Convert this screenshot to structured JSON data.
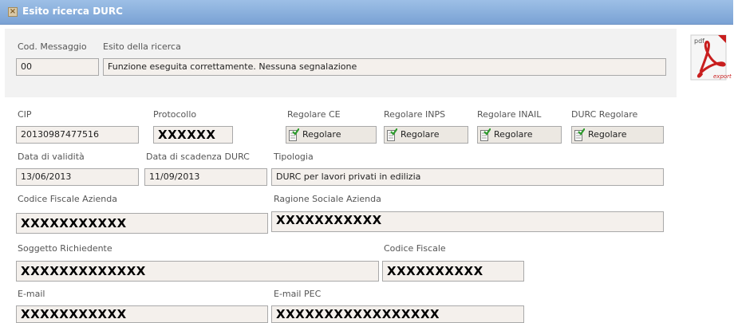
{
  "window": {
    "title": "Esito ricerca DURC",
    "close_icon": "close-icon"
  },
  "result": {
    "cod_label": "Cod. Messaggio",
    "cod_value": "00",
    "esito_label": "Esito della ricerca",
    "esito_value": "Funzione eseguita correttamente. Nessuna segnalazione"
  },
  "pdf_export": {
    "icon": "pdf-export-icon",
    "top_text": "pdf",
    "side_text": "export"
  },
  "details": {
    "cip_label": "CIP",
    "cip_value": "20130987477516",
    "protocollo_label": "Protocollo",
    "protocollo_value": "XXXXXX",
    "regolare_ce_label": "Regolare CE",
    "regolare_ce_value": "Regolare",
    "regolare_inps_label": "Regolare INPS",
    "regolare_inps_value": "Regolare",
    "regolare_inail_label": "Regolare INAIL",
    "regolare_inail_value": "Regolare",
    "durc_regolare_label": "DURC Regolare",
    "durc_regolare_value": "Regolare",
    "data_validita_label": "Data di validità",
    "data_validita_value": "13/06/2013",
    "data_scadenza_label": "Data di scadenza DURC",
    "data_scadenza_value": "11/09/2013",
    "tipologia_label": "Tipologia",
    "tipologia_value": "DURC per lavori privati in edilizia",
    "cf_azienda_label": "Codice Fiscale Azienda",
    "cf_azienda_value": "XXXXXXXXXXX",
    "ragione_sociale_label": "Ragione Sociale Azienda",
    "ragione_sociale_value": "XXXXXXXXXXX",
    "soggetto_label": "Soggetto Richiedente",
    "soggetto_value": "XXXXXXXXXXXXX",
    "cf_label": "Codice Fiscale",
    "cf_value": "XXXXXXXXXX",
    "email_label": "E-mail",
    "email_value": "XXXXXXXXXXX",
    "pec_label": "E-mail PEC",
    "pec_value": "XXXXXXXXXXXXXXXXX"
  }
}
